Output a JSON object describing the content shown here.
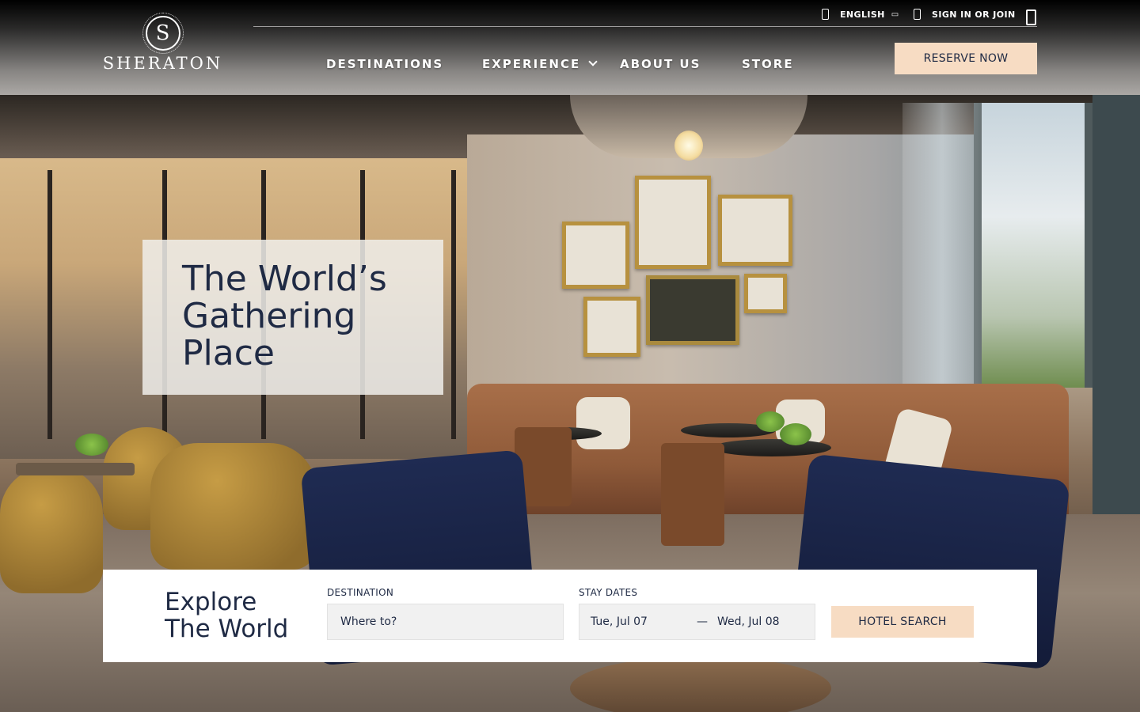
{
  "brand": {
    "logo_letter": "S",
    "name": "SHERATON"
  },
  "utility": {
    "language_label": "ENGLISH",
    "language_caret": "▭",
    "sign_in_label": "SIGN IN OR JOIN"
  },
  "nav": {
    "items": [
      {
        "label": "DESTINATIONS"
      },
      {
        "label": "EXPERIENCE"
      },
      {
        "label": "ABOUT US"
      },
      {
        "label": "STORE"
      }
    ],
    "reserve_label": "RESERVE NOW"
  },
  "hero": {
    "headline_line1": "The World’s",
    "headline_line2": "Gathering",
    "headline_line3": "Place"
  },
  "search": {
    "explore_line1": "Explore",
    "explore_line2": "The World",
    "destination_label": "DESTINATION",
    "destination_placeholder": "Where to?",
    "dates_label": "STAY DATES",
    "check_in": "Tue, Jul 07",
    "dates_separator": "—",
    "check_out": "Wed, Jul 08",
    "submit_label": "HOTEL SEARCH"
  },
  "colors": {
    "accent": "#f7dcc3",
    "text_primary": "#1f2a44"
  }
}
